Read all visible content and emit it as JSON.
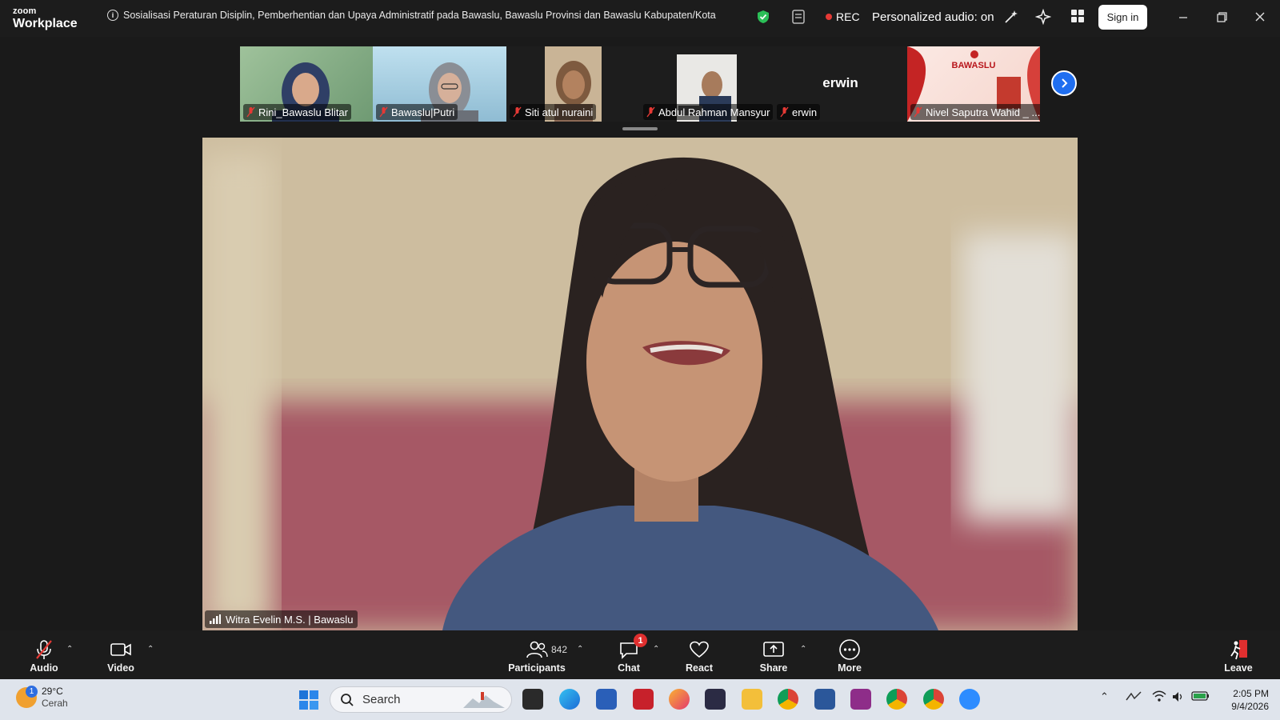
{
  "app": {
    "brand_top": "zoom",
    "brand_bottom": "Workplace"
  },
  "meeting": {
    "title": "Sosialisasi Peraturan Disiplin, Pemberhentian dan Upaya Administratif pada Bawaslu, Bawaslu Provinsi dan Bawaslu Kabupaten/Kota",
    "rec_label": "REC",
    "personalized_audio": "Personalized audio: on",
    "sign_in": "Sign in"
  },
  "thumbnails": [
    {
      "name": "Rini_Bawaslu Blitar"
    },
    {
      "name": "Bawaslu|Putri"
    },
    {
      "name": "Siti atul nuraini"
    },
    {
      "name": "Abdul Rahman Mansyur"
    },
    {
      "name": "erwin",
      "center_name": "erwin"
    },
    {
      "name": "Nivel Saputra Wahid _ ...",
      "poster_text": "BAWASLU"
    }
  ],
  "main_speaker": {
    "name": "Witra Evelin M.S. | Bawaslu"
  },
  "toolbar": {
    "audio": "Audio",
    "video": "Video",
    "participants": "Participants",
    "participant_count": "842",
    "chat": "Chat",
    "chat_badge": "1",
    "react": "React",
    "share": "Share",
    "more": "More",
    "leave": "Leave"
  },
  "taskbar": {
    "temperature": "29°C",
    "condition": "Cerah",
    "weather_badge": "1",
    "search": "Search",
    "time": "2:05 PM",
    "date": "9/4/2026"
  },
  "colors": {
    "accent": "#1f6ef0",
    "rec": "#e53935",
    "leave": "#e02f2f"
  }
}
